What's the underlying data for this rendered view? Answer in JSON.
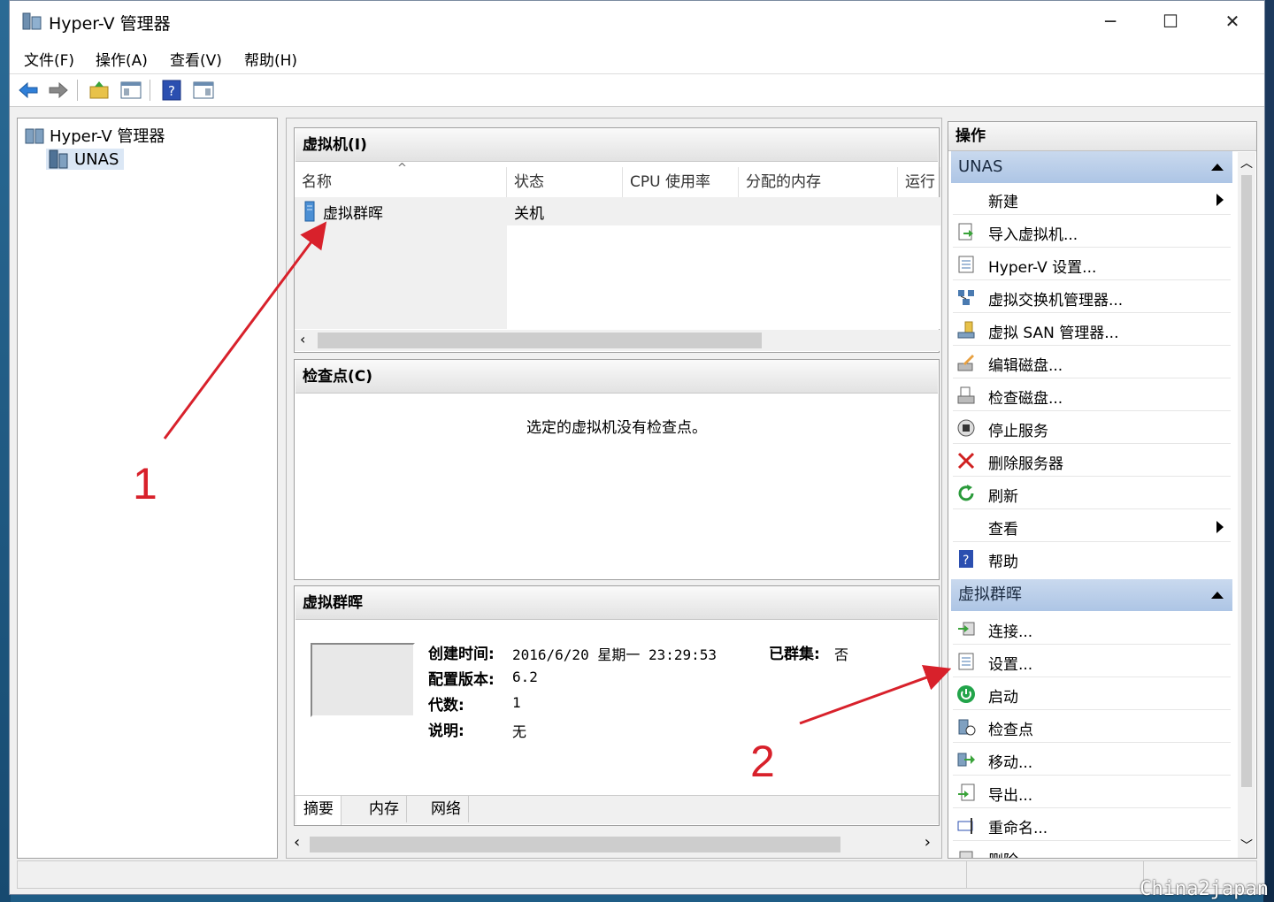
{
  "window": {
    "title": "Hyper-V 管理器"
  },
  "menu": {
    "file": "文件(F)",
    "action": "操作(A)",
    "view": "查看(V)",
    "help": "帮助(H)"
  },
  "tree": {
    "root": "Hyper-V 管理器",
    "server": "UNAS"
  },
  "vm_section": {
    "title": "虚拟机(I)",
    "columns": [
      "名称",
      "状态",
      "CPU 使用率",
      "分配的内存",
      "运行"
    ],
    "rows": [
      {
        "name": "虚拟群晖",
        "state": "关机"
      }
    ]
  },
  "checkpoint_section": {
    "title": "检查点(C)",
    "empty_text": "选定的虚拟机没有检查点。"
  },
  "detail_section": {
    "title": "虚拟群晖",
    "created_label": "创建时间:",
    "created_value": "2016/6/20 星期一 23:29:53",
    "clustered_label": "已群集:",
    "clustered_value": "否",
    "config_label": "配置版本:",
    "config_value": "6.2",
    "generation_label": "代数:",
    "generation_value": "1",
    "notes_label": "说明:",
    "notes_value": "无",
    "tabs": [
      "摘要",
      "内存",
      "网络"
    ]
  },
  "actions": {
    "title": "操作",
    "server_group": "UNAS",
    "server_items": [
      "新建",
      "导入虚拟机...",
      "Hyper-V 设置...",
      "虚拟交换机管理器...",
      "虚拟 SAN 管理器...",
      "编辑磁盘...",
      "检查磁盘...",
      "停止服务",
      "删除服务器",
      "刷新",
      "查看",
      "帮助"
    ],
    "vm_group": "虚拟群晖",
    "vm_items": [
      "连接...",
      "设置...",
      "启动",
      "检查点",
      "移动...",
      "导出...",
      "重命名...",
      "删除"
    ]
  },
  "annotations": {
    "one": "1",
    "two": "2",
    "color": "#d8212b"
  },
  "watermark": "China2japan"
}
